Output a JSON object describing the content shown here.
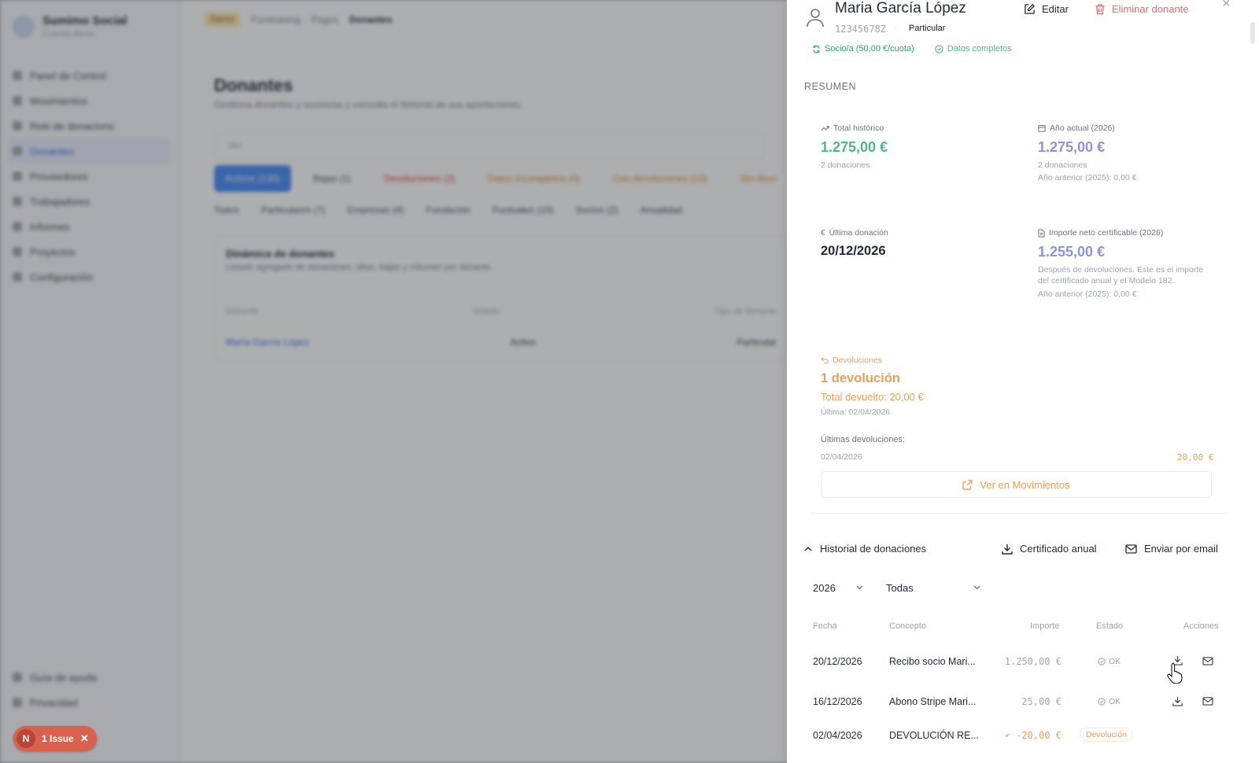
{
  "background": {
    "brand_title": "Sumimo Social",
    "brand_sub": "Cuenta demo",
    "nav": [
      "Panel de Control",
      "Movimientos",
      "Rols de donacions",
      "Donantes",
      "Proveedores",
      "Trabajadores",
      "Informes",
      "Proyectos",
      "Configuración"
    ],
    "nav_bottom": [
      "Guía de ayuda",
      "Privacidad"
    ],
    "breadcrumb": [
      "Demo",
      "Fundraising",
      "Pagos",
      "Donantes"
    ],
    "title": "Donantes",
    "subtitle": "Gestiona donantes y socios/as y consulta el historial de sus aportaciones.",
    "search_placeholder": "Ver",
    "tabs": [
      "Activos (130)",
      "Bajas (1)",
      "Devoluciones (2)",
      "Datos incompletos (4)",
      "Con devoluciones (10)",
      "Sin devo"
    ],
    "filters": [
      "Todos",
      "Particulares (7)",
      "Empresas (4)",
      "Fundación",
      "Puntuales (10)",
      "Socios (2)",
      "Anualidad"
    ],
    "card_title": "Dinámica de donantes",
    "card_sub": "Listado agregado de donaciones, altas, bajas y volumen por donante.",
    "table_head": [
      "Donante",
      "Estado",
      "Tipo de donante"
    ],
    "table_row": [
      "María García López",
      "Activo",
      "Particular"
    ]
  },
  "issue": {
    "avatar": "N",
    "label": "1 Issue"
  },
  "donor": {
    "name": "Maria García López",
    "id": "12345678Z",
    "type": "Particular",
    "edit_label": "Editar",
    "delete_label": "Eliminar donante",
    "badge_socio": "Socio/a (50,00 €/cuota)",
    "badge_complete": "Datos completos"
  },
  "summary": {
    "label": "RESUMEN",
    "total": {
      "label": "Total histórico",
      "value": "1.275,00 €",
      "sub": "2 donaciones"
    },
    "current_year": {
      "label": "Año actual (2026)",
      "value": "1.275,00 €",
      "sub": "2 donaciones",
      "sub2": "Año anterior (2025): 0,00 €"
    },
    "last_donation": {
      "label": "Última donación",
      "value": "20/12/2026"
    },
    "certifiable": {
      "label": "Importe neto certificable (2026)",
      "value": "1.255,00 €",
      "desc": "Después de devoluciones. Este es el importe del certificado anual y el Modelo 182.",
      "sub2": "Año anterior (2025): 0,00 €"
    },
    "returns": {
      "label": "Devoluciones",
      "value": "1 devolución",
      "total": "Total devuelto: 20,00 €",
      "last": "Última: 02/04/2026",
      "list_label": "Últimas devoluciones:",
      "item_date": "02/04/2026",
      "item_amount": "20,00 €",
      "view_button": "Ver en Movimientos"
    }
  },
  "history": {
    "title": "Historial de donaciones",
    "cert_button": "Certificado anual",
    "email_button": "Enviar por email",
    "year": "2026",
    "filter": "Todas",
    "columns": {
      "date": "Fecha",
      "concept": "Concepto",
      "amount": "Importe",
      "status": "Estado",
      "actions": "Acciones"
    },
    "rows": [
      {
        "date": "20/12/2026",
        "concept": "Recibo socio Mari...",
        "amount": "1.250,00 €",
        "status": "OK"
      },
      {
        "date": "16/12/2026",
        "concept": "Abono Stripe Mari...",
        "amount": "25,00 €",
        "status": "OK"
      },
      {
        "date": "02/04/2026",
        "concept": "DEVOLUCIÓN RE...",
        "amount": "-20,00 €",
        "status": "Devolución"
      }
    ]
  },
  "colors": {
    "green": "#4fb38d",
    "purple": "#8f93d6",
    "orange": "#e5a05c",
    "danger": "#e56b6b"
  }
}
